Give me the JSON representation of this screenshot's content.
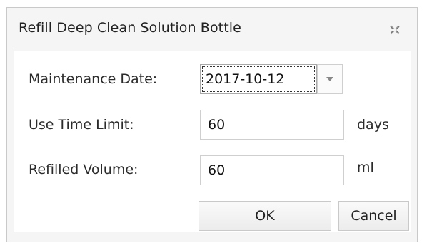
{
  "dialog": {
    "title": "Refill Deep Clean Solution Bottle",
    "close_icon": "close-icon"
  },
  "form": {
    "maintenance_date_label": "Maintenance Date:",
    "maintenance_date_value": "2017-10-12",
    "dropdown_icon": "chevron-down-icon",
    "use_time_limit_label": "Use Time Limit:",
    "use_time_limit_value": "60",
    "use_time_limit_unit": "days",
    "refilled_volume_label": "Refilled Volume:",
    "refilled_volume_value": "60",
    "refilled_volume_unit": "ml"
  },
  "buttons": {
    "ok_label": "OK",
    "cancel_label": "Cancel"
  },
  "colors": {
    "dialog_background": "#f5f5f5",
    "content_background": "#ffffff",
    "border": "#c3c3c3"
  }
}
